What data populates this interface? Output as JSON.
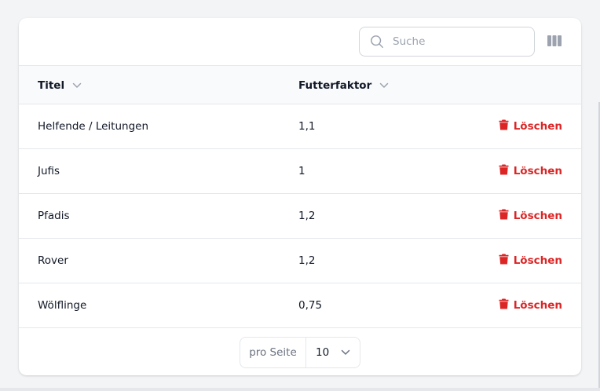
{
  "search": {
    "placeholder": "Suche",
    "value": ""
  },
  "columns_button_icon": "columns-icon",
  "table": {
    "headers": [
      {
        "label": "Titel",
        "sort_icon": "chevron-down-icon"
      },
      {
        "label": "Futterfaktor",
        "sort_icon": "chevron-down-icon"
      }
    ],
    "rows": [
      {
        "titel": "Helfende / Leitungen",
        "futterfaktor": "1,1",
        "action": "Löschen"
      },
      {
        "titel": "Jufis",
        "futterfaktor": "1",
        "action": "Löschen"
      },
      {
        "titel": "Pfadis",
        "futterfaktor": "1,2",
        "action": "Löschen"
      },
      {
        "titel": "Rover",
        "futterfaktor": "1,2",
        "action": "Löschen"
      },
      {
        "titel": "Wölflinge",
        "futterfaktor": "0,75",
        "action": "Löschen"
      }
    ]
  },
  "pagination": {
    "per_page_label": "pro Seite",
    "per_page_value": "10"
  },
  "colors": {
    "danger": "#dc2626",
    "border": "#e5e7eb",
    "muted": "#6b7280"
  }
}
